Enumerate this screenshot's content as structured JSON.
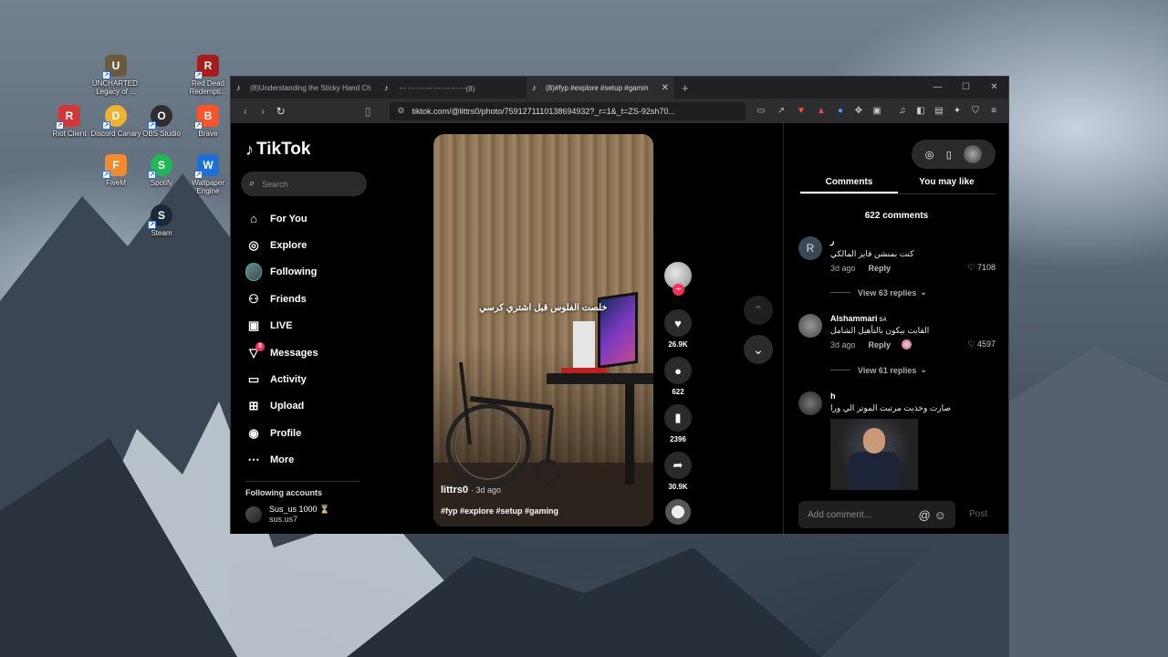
{
  "desktop": {
    "icons": [
      {
        "label": "UNCHARTED: Legacy of ...",
        "glyph": "U",
        "color": "#6b5a3e"
      },
      {
        "label": "Red Dead Redempti...",
        "glyph": "R",
        "color": "#a61c1c"
      },
      {
        "label": "Riot Client",
        "glyph": "R",
        "color": "#d13639"
      },
      {
        "label": "Discord Canary",
        "glyph": "D",
        "color": "#f0b232"
      },
      {
        "label": "OBS Studio",
        "glyph": "O",
        "color": "#302e31"
      },
      {
        "label": "Brave",
        "glyph": "B",
        "color": "#fb542b"
      },
      {
        "label": "FiveM",
        "glyph": "F",
        "color": "#f28b30"
      },
      {
        "label": "Spotify",
        "glyph": "S",
        "color": "#1db954"
      },
      {
        "label": "Wallpaper Engine",
        "glyph": "W",
        "color": "#1c6fd6"
      },
      {
        "label": "Steam",
        "glyph": "S",
        "color": "#1b2838"
      }
    ]
  },
  "browser": {
    "tabs": [
      {
        "title": "(8)Understanding the Sticky Hand Ch"
      },
      {
        "title": "᠁᠁᠁᠁᠁᠁᠁᠁(8)"
      },
      {
        "title": "(8)#fyp #explore #setup #gamin"
      }
    ],
    "url": "tiktok.com/@littrs0/photo/7591271110138694932?_r=1&_t=ZS-92sh70..."
  },
  "tiktok": {
    "logo": "TikTok",
    "search_placeholder": "Search",
    "nav": [
      {
        "label": "For You",
        "icon": "home-icon"
      },
      {
        "label": "Explore",
        "icon": "compass-icon"
      },
      {
        "label": "Following",
        "icon": "following-avatar"
      },
      {
        "label": "Friends",
        "icon": "friends-icon"
      },
      {
        "label": "LIVE",
        "icon": "live-icon"
      },
      {
        "label": "Messages",
        "icon": "messages-icon",
        "badge": "8"
      },
      {
        "label": "Activity",
        "icon": "activity-icon"
      },
      {
        "label": "Upload",
        "icon": "upload-icon"
      },
      {
        "label": "Profile",
        "icon": "profile-icon"
      },
      {
        "label": "More",
        "icon": "more-icon"
      }
    ],
    "following_accounts_title": "Following accounts",
    "following_account": {
      "name": "Sus_us 1000 ⏳",
      "username": "sus.us7"
    },
    "post": {
      "overlay_text": "خلصت الفلوس قبل اشتري كرسي",
      "username": "littrs0",
      "age": "· 3d ago",
      "tags": "#fyp #explore #setup #gaming"
    },
    "actions": {
      "likes": "26.9K",
      "comments": "622",
      "saves": "2396",
      "shares": "30.9K"
    },
    "panel": {
      "tab_comments": "Comments",
      "tab_may_like": "You may like",
      "comment_count": "622 comments",
      "comments": [
        {
          "avatar": "R",
          "user": "ر",
          "text": "كنت بمنشن فايز المالكي",
          "age": "3d ago",
          "reply": "Reply",
          "likes": "7108",
          "view_replies": "View 63 replies"
        },
        {
          "avatar": "",
          "user": "Alshammari",
          "badge": "SA",
          "text": "القايت بيكون بالتأهيل الشامل",
          "age": "3d ago",
          "reply": "Reply",
          "likes": "4597",
          "view_replies": "View 61 replies"
        },
        {
          "avatar": "",
          "user": "h",
          "text": "صارت وخذيت مرتبت الموتر الي ورا"
        }
      ],
      "add_comment_placeholder": "Add comment...",
      "post_label": "Post"
    }
  }
}
